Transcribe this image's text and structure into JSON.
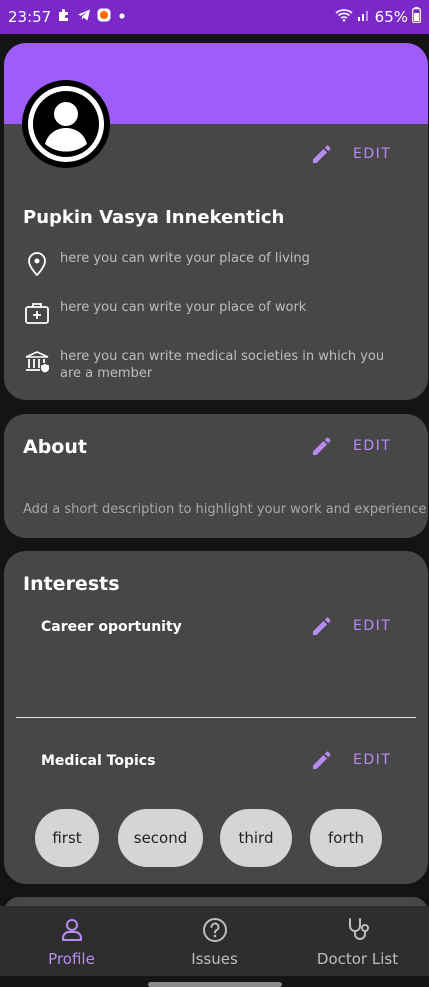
{
  "status_bar": {
    "time": "23:57",
    "battery": "65%",
    "icons": [
      "puzzle-icon",
      "telegram-icon",
      "app-notification-icon",
      "dot-icon",
      "wifi-icon",
      "signal-icon",
      "battery-icon"
    ]
  },
  "colors": {
    "status_bar": "#7a29c8",
    "banner": "#9e5cf8",
    "accent": "#b98cf5",
    "card": "#474747",
    "background": "#141414",
    "chip": "#d5d5d5",
    "nav": "#2e2e2e"
  },
  "profile": {
    "name": "Pupkin Vasya Innekentich",
    "edit_label": "EDIT",
    "living_placeholder": "here you can write your place of living",
    "work_placeholder": "here you can write your place of work",
    "societies_placeholder": "here you can write medical societies in which you are a member"
  },
  "about": {
    "title": "About",
    "edit_label": "EDIT",
    "description": "Add a short description to highlight your work and experience"
  },
  "interests": {
    "title": "Interests",
    "career": {
      "title": "Career oportunity",
      "edit_label": "EDIT"
    },
    "medical": {
      "title": "Medical Topics",
      "edit_label": "EDIT",
      "chips": [
        "first",
        "second",
        "third",
        "forth"
      ]
    }
  },
  "bottom_nav": {
    "active": "Profile",
    "items": [
      {
        "label": "Profile",
        "icon": "person-icon"
      },
      {
        "label": "Issues",
        "icon": "question-circle-icon"
      },
      {
        "label": "Doctor List",
        "icon": "stethoscope-icon"
      }
    ]
  }
}
